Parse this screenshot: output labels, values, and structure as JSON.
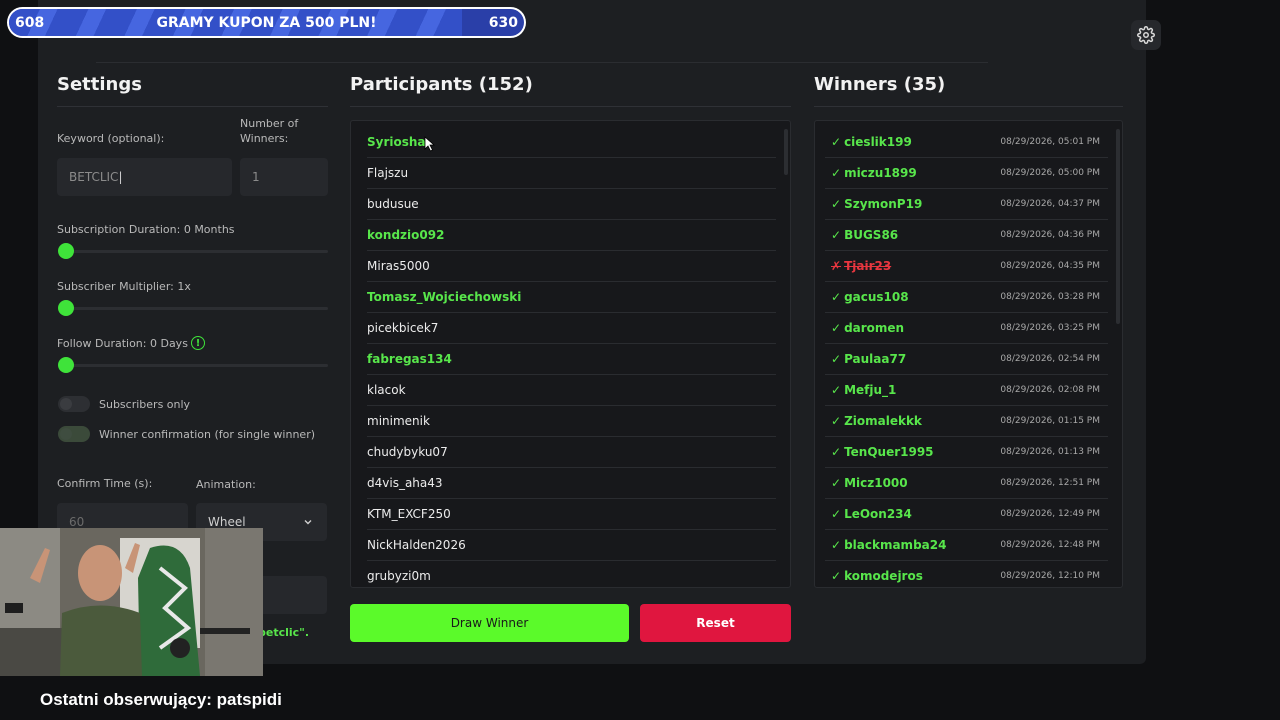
{
  "banner": {
    "start": "608",
    "title": "GRAMY KUPON ZA 500 PLN!",
    "end": "630",
    "progress": 0.88
  },
  "settings": {
    "title": "Settings",
    "keyword_label": "Keyword (optional):",
    "keyword_value": "BETCLIC",
    "winners_label": "Number of Winners:",
    "winners_value": "1",
    "sub_duration_label": "Subscription Duration: 0 Months",
    "sub_duration_value": 0,
    "sub_multiplier_label": "Subscriber Multiplier: 1x",
    "follow_duration_label": "Follow Duration:  0  Days",
    "subscribers_only_label": "Subscribers only",
    "winner_confirmation_label": "Winner confirmation (for single winner)",
    "confirm_time_label": "Confirm Time (s):",
    "confirm_time_value": "60",
    "animation_label": "Animation:",
    "animation_value": "Wheel",
    "keyword_hint": "betclic\"."
  },
  "participants": {
    "title": "Participants (152)",
    "items": [
      {
        "name": "Syriosha",
        "highlight": true
      },
      {
        "name": "Flajszu",
        "highlight": false
      },
      {
        "name": "budusue",
        "highlight": false
      },
      {
        "name": "kondzio092",
        "highlight": true
      },
      {
        "name": "Miras5000",
        "highlight": false
      },
      {
        "name": "Tomasz_Wojciechowski",
        "highlight": true
      },
      {
        "name": "picekbicek7",
        "highlight": false
      },
      {
        "name": "fabregas134",
        "highlight": true
      },
      {
        "name": "klacok",
        "highlight": false
      },
      {
        "name": "minimenik",
        "highlight": false
      },
      {
        "name": "chudybyku07",
        "highlight": false
      },
      {
        "name": "d4vis_aha43",
        "highlight": false
      },
      {
        "name": "KTM_EXCF250",
        "highlight": false
      },
      {
        "name": "NickHalden2026",
        "highlight": false
      },
      {
        "name": "grubyzi0m",
        "highlight": false
      }
    ]
  },
  "winners": {
    "title": "Winners (35)",
    "items": [
      {
        "mark": "✓",
        "name": "cieslik199",
        "date": "08/29/2026, 05:01 PM",
        "rejected": false
      },
      {
        "mark": "✓",
        "name": "miczu1899",
        "date": "08/29/2026, 05:00 PM",
        "rejected": false
      },
      {
        "mark": "✓",
        "name": "SzymonP19",
        "date": "08/29/2026, 04:37 PM",
        "rejected": false
      },
      {
        "mark": "✓",
        "name": "BUGS86",
        "date": "08/29/2026, 04:36 PM",
        "rejected": false
      },
      {
        "mark": "✗",
        "name": "Tjair23",
        "date": "08/29/2026, 04:35 PM",
        "rejected": true
      },
      {
        "mark": "✓",
        "name": "gacus108",
        "date": "08/29/2026, 03:28 PM",
        "rejected": false
      },
      {
        "mark": "✓",
        "name": "daromen",
        "date": "08/29/2026, 03:25 PM",
        "rejected": false
      },
      {
        "mark": "✓",
        "name": "Paulaa77",
        "date": "08/29/2026, 02:54 PM",
        "rejected": false
      },
      {
        "mark": "✓",
        "name": "Mefju_1",
        "date": "08/29/2026, 02:08 PM",
        "rejected": false
      },
      {
        "mark": "✓",
        "name": "Ziomalekkk",
        "date": "08/29/2026, 01:15 PM",
        "rejected": false
      },
      {
        "mark": "✓",
        "name": "TenQuer1995",
        "date": "08/29/2026, 01:13 PM",
        "rejected": false
      },
      {
        "mark": "✓",
        "name": "Micz1000",
        "date": "08/29/2026, 12:51 PM",
        "rejected": false
      },
      {
        "mark": "✓",
        "name": "LeOon234",
        "date": "08/29/2026, 12:49 PM",
        "rejected": false
      },
      {
        "mark": "✓",
        "name": "blackmamba24",
        "date": "08/29/2026, 12:48 PM",
        "rejected": false
      },
      {
        "mark": "✓",
        "name": "komodejros",
        "date": "08/29/2026, 12:10 PM",
        "rejected": false
      }
    ]
  },
  "buttons": {
    "draw": "Draw Winner",
    "reset": "Reset"
  },
  "footer": {
    "text": "Ostatni obserwujący: patspidi"
  },
  "colors": {
    "accent": "#5bfa2a",
    "danger": "#e0163f",
    "green_text": "#58e64b"
  }
}
